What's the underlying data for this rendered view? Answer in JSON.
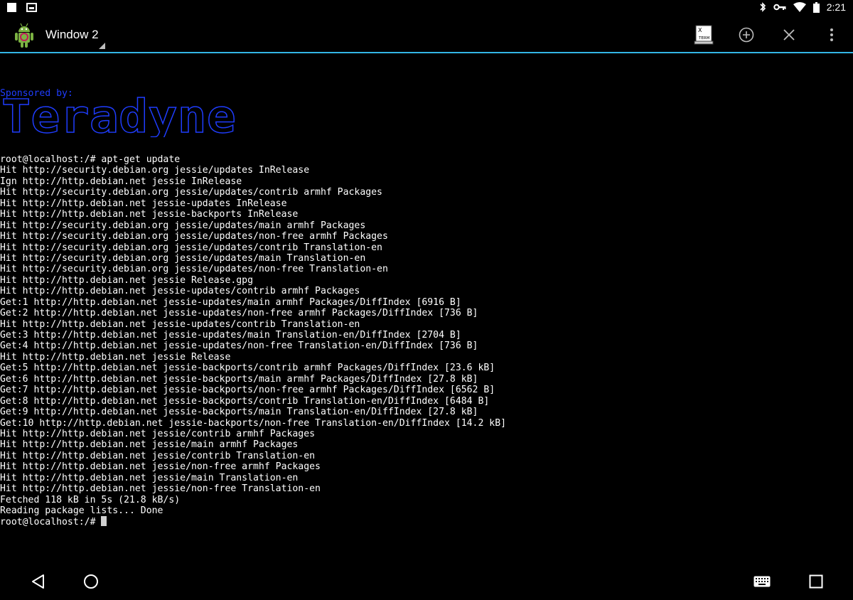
{
  "status_bar": {
    "time": "2:21",
    "icons": [
      "stop-square-icon",
      "image-icon",
      "bluetooth-icon",
      "vpn-key-icon",
      "wifi-icon",
      "battery-icon"
    ]
  },
  "action_bar": {
    "window_title": "Window 2",
    "app_icon": "android-debian-icon",
    "xterm_label_top": "X",
    "xterm_label_bottom": "TERM",
    "actions": [
      "new-window-icon",
      "close-window-icon",
      "overflow-menu-icon"
    ]
  },
  "terminal": {
    "sponsor_label": "Sponsored by:",
    "banner_text": "Teradyne",
    "lines": [
      "root@localhost:/# apt-get update",
      "Hit http://security.debian.org jessie/updates InRelease",
      "Ign http://http.debian.net jessie InRelease",
      "Hit http://security.debian.org jessie/updates/contrib armhf Packages",
      "Hit http://http.debian.net jessie-updates InRelease",
      "Hit http://http.debian.net jessie-backports InRelease",
      "Hit http://security.debian.org jessie/updates/main armhf Packages",
      "Hit http://security.debian.org jessie/updates/non-free armhf Packages",
      "Hit http://security.debian.org jessie/updates/contrib Translation-en",
      "Hit http://security.debian.org jessie/updates/main Translation-en",
      "Hit http://security.debian.org jessie/updates/non-free Translation-en",
      "Hit http://http.debian.net jessie Release.gpg",
      "Hit http://http.debian.net jessie-updates/contrib armhf Packages",
      "Get:1 http://http.debian.net jessie-updates/main armhf Packages/DiffIndex [6916 B]",
      "Get:2 http://http.debian.net jessie-updates/non-free armhf Packages/DiffIndex [736 B]",
      "Hit http://http.debian.net jessie-updates/contrib Translation-en",
      "Get:3 http://http.debian.net jessie-updates/main Translation-en/DiffIndex [2704 B]",
      "Get:4 http://http.debian.net jessie-updates/non-free Translation-en/DiffIndex [736 B]",
      "Hit http://http.debian.net jessie Release",
      "Get:5 http://http.debian.net jessie-backports/contrib armhf Packages/DiffIndex [23.6 kB]",
      "Get:6 http://http.debian.net jessie-backports/main armhf Packages/DiffIndex [27.8 kB]",
      "Get:7 http://http.debian.net jessie-backports/non-free armhf Packages/DiffIndex [6562 B]",
      "Get:8 http://http.debian.net jessie-backports/contrib Translation-en/DiffIndex [6484 B]",
      "Get:9 http://http.debian.net jessie-backports/main Translation-en/DiffIndex [27.8 kB]",
      "Get:10 http://http.debian.net jessie-backports/non-free Translation-en/DiffIndex [14.2 kB]",
      "Hit http://http.debian.net jessie/contrib armhf Packages",
      "Hit http://http.debian.net jessie/main armhf Packages",
      "Hit http://http.debian.net jessie/contrib Translation-en",
      "Hit http://http.debian.net jessie/non-free armhf Packages",
      "Hit http://http.debian.net jessie/main Translation-en",
      "Hit http://http.debian.net jessie/non-free Translation-en",
      "Fetched 118 kB in 5s (21.8 kB/s)",
      "Reading package lists... Done"
    ],
    "prompt": "root@localhost:/# "
  },
  "nav_bar": {
    "buttons": [
      "back-icon",
      "home-icon",
      "keyboard-icon",
      "recents-icon"
    ]
  },
  "colors": {
    "background": "#000000",
    "text": "#ffffff",
    "sponsor_blue": "#1f3dff",
    "accent_line": "#33b5e5"
  }
}
